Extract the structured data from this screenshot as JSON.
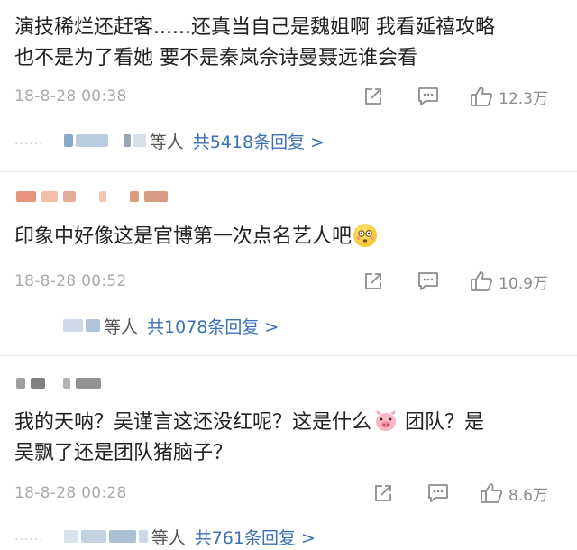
{
  "colors": {
    "link": "#3a6fb5",
    "meta_gray": "#aaaaaa",
    "icon_gray": "#8c8c8c"
  },
  "comments": [
    {
      "text_line1": "演技稀烂还赶客......还真当自己是魏姐啊 我看延禧攻略",
      "text_line2": "也不是为了看她 要不是秦岚佘诗曼聂远谁会看",
      "time": "18-8-28 00:38",
      "likes": "12.3万",
      "reply_dots": "......",
      "reply_deng": "等人",
      "reply_total": "共5418条回复 >"
    },
    {
      "text_pre": "印象中好像这是官博第一次点名艺人吧",
      "emoji": "flushed-face-emoji",
      "time": "18-8-28 00:52",
      "likes": "10.9万",
      "reply_deng": "等人",
      "reply_total": "共1078条回复 >"
    },
    {
      "text_pre": "我的天呐？吴谨言这还没红呢？这是什么",
      "emoji": "pig-face-emoji",
      "text_post": " 团队？是",
      "text_line2": "吴飘了还是团队猪脑子？",
      "time": "18-8-28 00:28",
      "likes": "8.6万",
      "reply_dots": "......",
      "reply_deng": "等人",
      "reply_total": "共761条回复 >"
    }
  ],
  "icons": [
    "share-icon",
    "comment-icon",
    "like-icon"
  ]
}
